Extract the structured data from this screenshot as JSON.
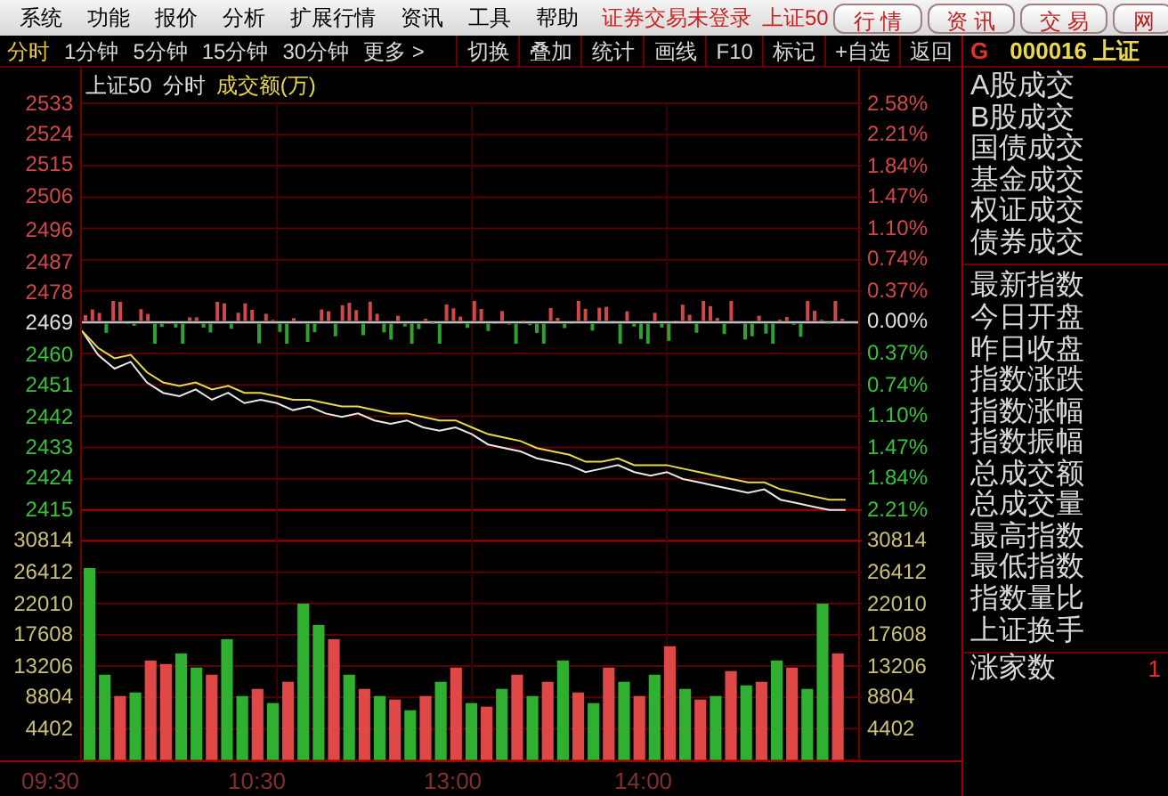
{
  "menu_bar": {
    "items": [
      "系统",
      "功能",
      "报价",
      "分析",
      "扩展行情",
      "资讯",
      "工具",
      "帮助"
    ],
    "status": "证券交易未登录",
    "instrument": "上证50",
    "buttons": [
      "行 情",
      "资 讯",
      "交 易",
      "网"
    ]
  },
  "toolbar": {
    "periods": [
      {
        "label": "分时",
        "selected": true
      },
      {
        "label": "1分钟",
        "selected": false
      },
      {
        "label": "5分钟",
        "selected": false
      },
      {
        "label": "15分钟",
        "selected": false
      },
      {
        "label": "30分钟",
        "selected": false
      },
      {
        "label": "更多 >",
        "selected": false
      }
    ],
    "actions": [
      "切换",
      "叠加",
      "统计",
      "画线",
      "F10",
      "标记",
      "+自选",
      "返回"
    ]
  },
  "chart_header": {
    "name": "上证50",
    "mode": "分时",
    "indicator": "成交额(万)"
  },
  "right_axis": [
    {
      "label": "2.58%",
      "kind": "up"
    },
    {
      "label": "2.21%",
      "kind": "up"
    },
    {
      "label": "1.84%",
      "kind": "up"
    },
    {
      "label": "1.47%",
      "kind": "up"
    },
    {
      "label": "1.10%",
      "kind": "up"
    },
    {
      "label": "0.74%",
      "kind": "up"
    },
    {
      "label": "0.37%",
      "kind": "up"
    },
    {
      "label": "0.00%",
      "kind": "flat"
    },
    {
      "label": "0.37%",
      "kind": "down"
    },
    {
      "label": "0.74%",
      "kind": "down"
    },
    {
      "label": "1.10%",
      "kind": "down"
    },
    {
      "label": "1.47%",
      "kind": "down"
    },
    {
      "label": "1.84%",
      "kind": "down"
    },
    {
      "label": "2.21%",
      "kind": "down"
    },
    {
      "label": "30814",
      "kind": "volume"
    },
    {
      "label": "26412",
      "kind": "volume"
    },
    {
      "label": "22010",
      "kind": "volume"
    },
    {
      "label": "17608",
      "kind": "volume"
    },
    {
      "label": "13206",
      "kind": "volume"
    },
    {
      "label": "8804",
      "kind": "volume"
    },
    {
      "label": "4402",
      "kind": "volume"
    }
  ],
  "price_chart": {
    "chart_data": {
      "type": "line",
      "categories": [
        null,
        null,
        null,
        null,
        null,
        null,
        null,
        null,
        null,
        null,
        null,
        null,
        null,
        null,
        null,
        null,
        null,
        null,
        null,
        null,
        null,
        null,
        null,
        null,
        null,
        null,
        null,
        null,
        null,
        null,
        null,
        null,
        null,
        null,
        null,
        null,
        null,
        null,
        null,
        null,
        null,
        null,
        null,
        null,
        null,
        null,
        null,
        null
      ],
      "ylim": [
        2415,
        2533
      ],
      "grid": true,
      "yticks": [
        {
          "value": 2533,
          "label": "2533"
        },
        {
          "value": 2524,
          "label": "2524"
        },
        {
          "value": 2515,
          "label": "2515"
        },
        {
          "value": 2506,
          "label": "2506"
        },
        {
          "value": 2496,
          "label": "2496"
        },
        {
          "value": 2487,
          "label": "2487"
        },
        {
          "value": 2478,
          "label": "2478"
        },
        {
          "value": 2469,
          "label": "2469"
        },
        {
          "value": 2460,
          "label": "2460"
        },
        {
          "value": 2451,
          "label": "2451"
        },
        {
          "value": 2442,
          "label": "2442"
        },
        {
          "value": 2433,
          "label": "2433"
        },
        {
          "value": 2424,
          "label": "2424"
        },
        {
          "value": 2415,
          "label": "2415"
        }
      ],
      "series": [
        {
          "color": "#e8e8e8",
          "values": [
            2467,
            2460,
            2456,
            2458,
            2452,
            2449,
            2448,
            2450,
            2447,
            2449,
            2446,
            2447,
            2446,
            2444,
            2445,
            2443,
            2442,
            2443,
            2441,
            2440,
            2441,
            2439,
            2438,
            2439,
            2437,
            2434,
            2433,
            2432,
            2430,
            2429,
            2428,
            2426,
            2427,
            2428,
            2426,
            2425,
            2426,
            2424,
            2423,
            2422,
            2421,
            2420,
            2421,
            2418,
            2417,
            2416,
            2415,
            2415
          ]
        },
        {
          "color": "#e8d84a",
          "values": [
            2467,
            2462,
            2459,
            2460,
            2455,
            2452,
            2451,
            2452,
            2450,
            2451,
            2449,
            2449,
            2448,
            2447,
            2447,
            2446,
            2445,
            2445,
            2444,
            2443,
            2443,
            2442,
            2441,
            2441,
            2439,
            2437,
            2436,
            2435,
            2433,
            2432,
            2431,
            2429,
            2429,
            2430,
            2428,
            2428,
            2428,
            2427,
            2426,
            2425,
            2424,
            2423,
            2423,
            2421,
            2420,
            2419,
            2418,
            2418
          ]
        }
      ]
    }
  },
  "volume_chart": {
    "chart_data": {
      "type": "bar",
      "stacked": true,
      "ylim": [
        0,
        30814
      ],
      "grid": true,
      "categories": [
        null,
        null,
        null,
        null,
        null,
        null,
        null,
        null,
        null,
        null,
        null,
        null,
        null,
        null,
        null,
        null,
        null,
        null,
        null,
        null,
        null,
        null,
        null,
        null,
        null,
        null,
        null,
        null,
        null,
        null,
        null,
        null,
        null,
        null,
        null,
        null,
        null,
        null,
        null,
        null,
        null,
        null,
        null,
        null,
        null,
        null,
        null,
        null,
        null,
        null
      ],
      "yticks": [
        {
          "value": 30814,
          "label": "30814"
        },
        {
          "value": 26412,
          "label": "26412"
        },
        {
          "value": 22010,
          "label": "22010"
        },
        {
          "value": 17608,
          "label": "17608"
        },
        {
          "value": 13206,
          "label": "13206"
        },
        {
          "value": 8804,
          "label": "8804"
        },
        {
          "value": 4402,
          "label": "4402"
        }
      ],
      "series": [
        {
          "color": "#e04848",
          "values": [
            null,
            null,
            9000,
            null,
            14000,
            13500,
            null,
            null,
            12000,
            null,
            null,
            10000,
            null,
            11000,
            null,
            null,
            17000,
            null,
            10000,
            null,
            8500,
            null,
            9000,
            null,
            13000,
            null,
            7500,
            null,
            12000,
            null,
            11000,
            null,
            9500,
            null,
            13000,
            null,
            9000,
            null,
            16000,
            null,
            8500,
            null,
            12500,
            null,
            11000,
            null,
            13000,
            null,
            null,
            15000
          ]
        },
        {
          "color": "#30b030",
          "values": [
            27000,
            12000,
            null,
            9500,
            null,
            null,
            15000,
            13000,
            null,
            17000,
            9000,
            null,
            8000,
            null,
            22000,
            19000,
            null,
            12000,
            null,
            9000,
            null,
            7000,
            null,
            11000,
            null,
            8000,
            null,
            10000,
            null,
            9000,
            null,
            14000,
            null,
            8000,
            null,
            11000,
            null,
            12000,
            null,
            10000,
            null,
            9000,
            null,
            10500,
            null,
            14000,
            null,
            10000,
            22000,
            null
          ]
        }
      ]
    }
  },
  "time_axis": [
    "09:30",
    "10:30",
    "13:00",
    "14:00"
  ],
  "quote_panel": {
    "market": "G",
    "code": "000016",
    "name": "上证",
    "group_1": [
      "A股成交",
      "B股成交",
      "国债成交",
      "基金成交",
      "权证成交",
      "债券成交"
    ],
    "group_2": [
      "最新指数",
      "今日开盘",
      "昨日收盘",
      "指数涨跌",
      "指数涨幅",
      "指数振幅",
      "总成交额",
      "总成交量",
      "最高指数",
      "最低指数",
      "指数量比",
      "上证换手"
    ],
    "advancers": {
      "label": "涨家数",
      "value": "1"
    }
  }
}
